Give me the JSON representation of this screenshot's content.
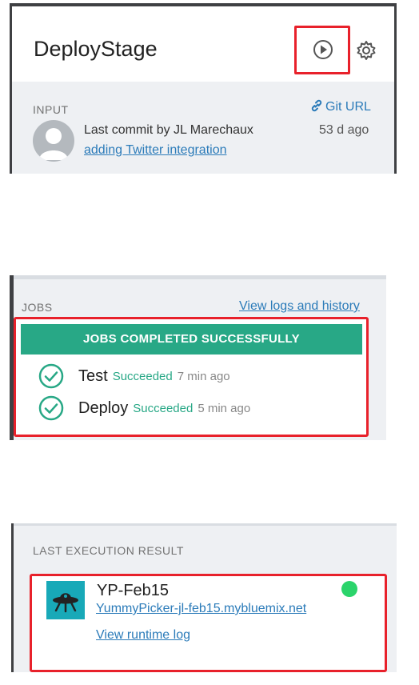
{
  "stage": {
    "title": "DeployStage",
    "play_icon": "play-circle-icon",
    "settings_icon": "gear-icon",
    "input_label": "INPUT",
    "git_url_label": "Git URL",
    "commit_text": "Last commit by JL Marechaux",
    "commit_message": "adding Twitter integration",
    "commit_age": "53 d ago"
  },
  "jobs": {
    "label": "JOBS",
    "view_logs_label": "View logs and history",
    "banner": "JOBS COMPLETED SUCCESSFULLY",
    "items": [
      {
        "name": "Test",
        "status": "Succeeded",
        "time": "7 min ago"
      },
      {
        "name": "Deploy",
        "status": "Succeeded",
        "time": "5 min ago"
      }
    ]
  },
  "last_execution": {
    "label": "LAST EXECUTION RESULT",
    "app_name": "YP-Feb15",
    "app_url": "YummyPicker-jl-feb15.mybluemix.net",
    "runtime_log_label": "View runtime log",
    "status_color": "#2bd46b"
  },
  "colors": {
    "accent_green": "#28a886",
    "highlight_red": "#e8212b",
    "link_blue": "#2b7bb9",
    "app_icon_teal": "#18a9b8"
  }
}
